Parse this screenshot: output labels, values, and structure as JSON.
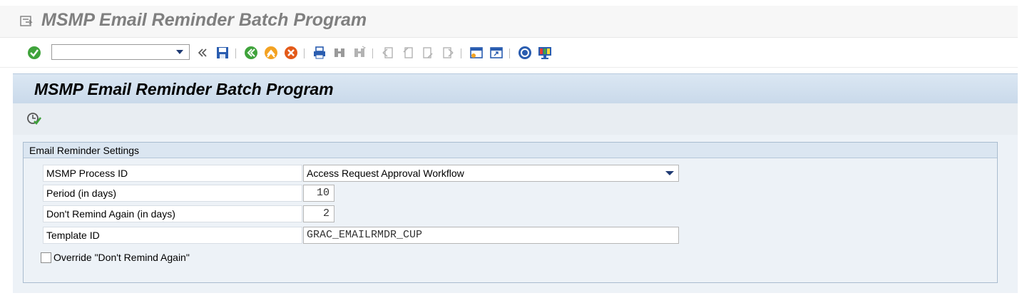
{
  "app": {
    "title": "MSMP Email Reminder Batch Program"
  },
  "toolbar": {
    "command_field": {
      "value": "",
      "placeholder": ""
    },
    "icons": [
      "enter-icon",
      "command-dropdown-icon",
      "collapse-icon",
      "save-icon",
      "back-icon",
      "exit-icon",
      "cancel-icon",
      "print-icon",
      "find-icon",
      "find-next-icon",
      "first-page-icon",
      "previous-page-icon",
      "next-page-icon",
      "last-page-icon",
      "create-session-icon",
      "shortcut-icon",
      "help-icon",
      "customize-layout-icon"
    ]
  },
  "page": {
    "title": "MSMP Email Reminder Batch Program"
  },
  "app_toolbar": {
    "execute_icon": "execute-icon"
  },
  "group": {
    "title": "Email Reminder Settings",
    "fields": {
      "process_id": {
        "label": "MSMP Process ID",
        "value": "Access Request Approval Workflow"
      },
      "period": {
        "label": "Period (in days)",
        "value": "10"
      },
      "dont_remind": {
        "label": "Don't Remind Again (in days)",
        "value": "2"
      },
      "template_id": {
        "label": "Template ID",
        "value": "GRAC_EMAILRMDR_CUP"
      }
    },
    "override": {
      "label": "Override \"Don't Remind Again\"",
      "checked": false
    }
  },
  "colors": {
    "accent": "#1f3a73",
    "header_bg": "#c9d9ea",
    "content_bg": "#edf2f7"
  }
}
